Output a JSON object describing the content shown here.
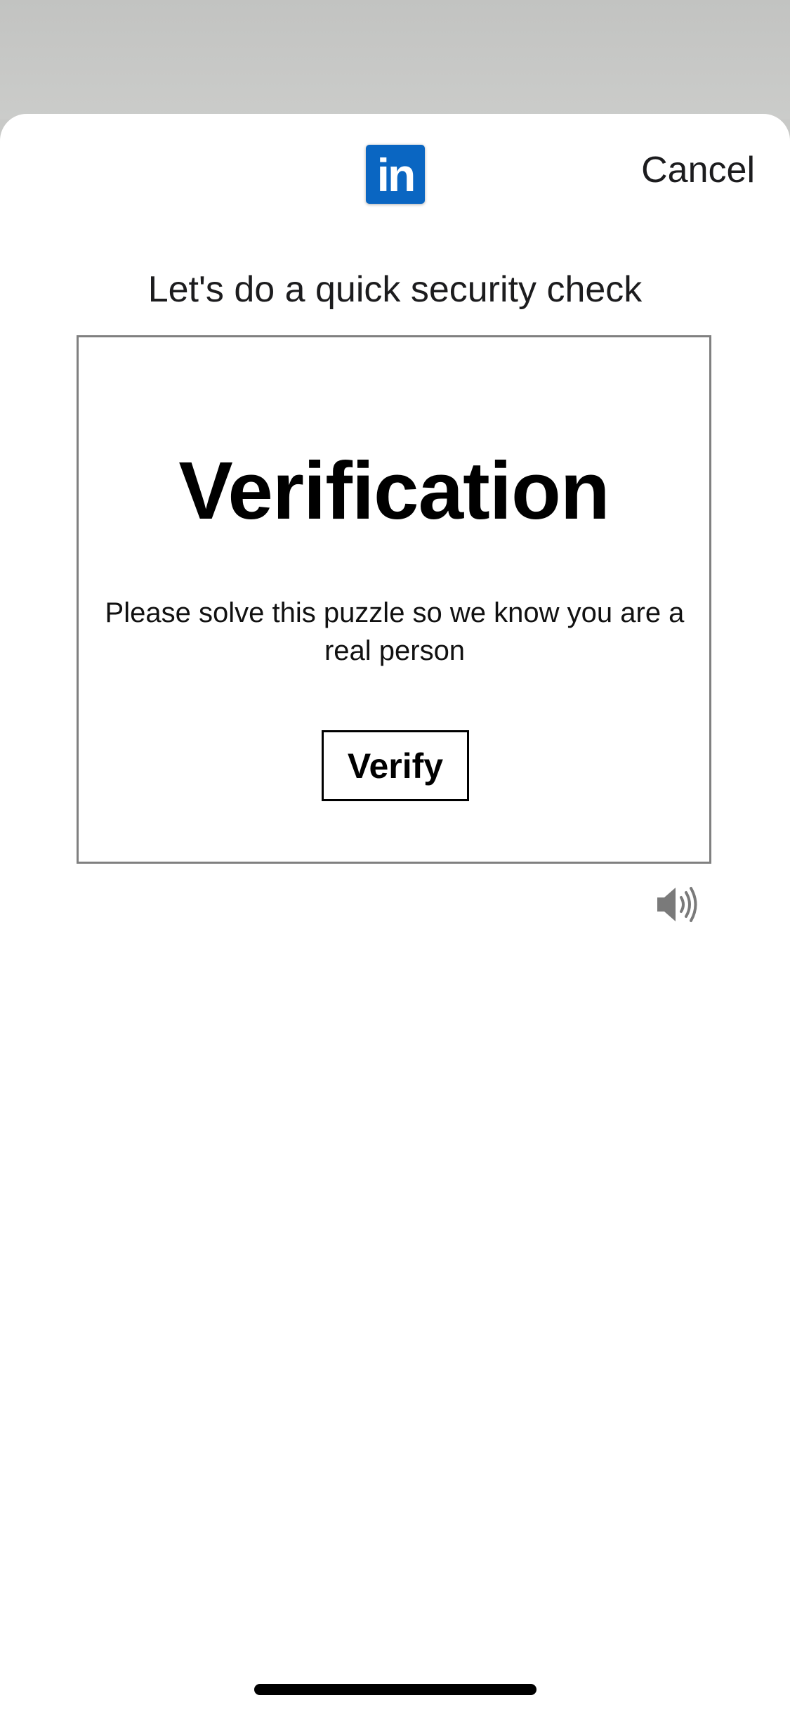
{
  "header": {
    "logo_text": "in",
    "cancel_label": "Cancel"
  },
  "main": {
    "heading": "Let's do a quick security check"
  },
  "challenge": {
    "title": "Verification",
    "description": "Please solve this puzzle so we know you are a real person",
    "verify_label": "Verify"
  },
  "icons": {
    "logo": "linkedin-logo-icon",
    "audio": "speaker-audio-icon"
  },
  "colors": {
    "brand": "#0a66c2",
    "backdrop": "#c8c9c7",
    "card_border": "#808080"
  }
}
